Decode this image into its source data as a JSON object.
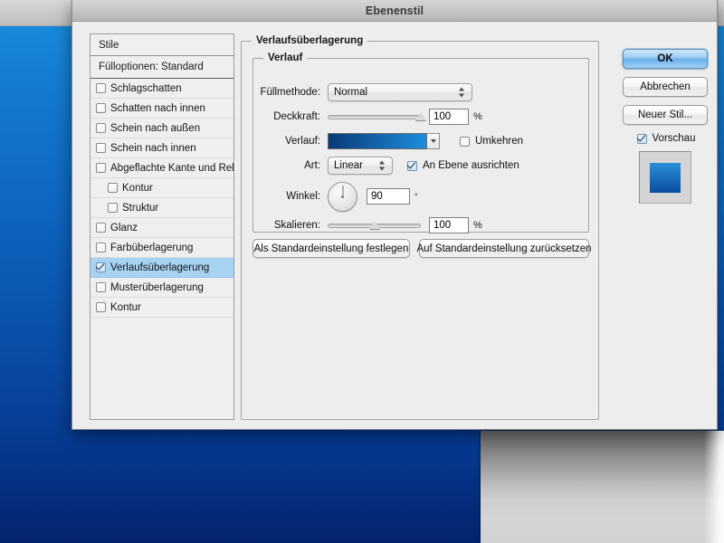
{
  "window": {
    "title": "Ebenenstil"
  },
  "styles_panel": {
    "header": "Stile",
    "fill_options": "Fülloptionen: Standard",
    "items": [
      {
        "label": "Schlagschatten",
        "checked": false,
        "indent": false,
        "selected": false
      },
      {
        "label": "Schatten nach innen",
        "checked": false,
        "indent": false,
        "selected": false
      },
      {
        "label": "Schein nach außen",
        "checked": false,
        "indent": false,
        "selected": false
      },
      {
        "label": "Schein nach innen",
        "checked": false,
        "indent": false,
        "selected": false
      },
      {
        "label": "Abgeflachte Kante und Relief",
        "checked": false,
        "indent": false,
        "selected": false
      },
      {
        "label": "Kontur",
        "checked": false,
        "indent": true,
        "selected": false
      },
      {
        "label": "Struktur",
        "checked": false,
        "indent": true,
        "selected": false
      },
      {
        "label": "Glanz",
        "checked": false,
        "indent": false,
        "selected": false
      },
      {
        "label": "Farbüberlagerung",
        "checked": false,
        "indent": false,
        "selected": false
      },
      {
        "label": "Verlaufsüberlagerung",
        "checked": true,
        "indent": false,
        "selected": true
      },
      {
        "label": "Musterüberlagerung",
        "checked": false,
        "indent": false,
        "selected": false
      },
      {
        "label": "Kontur",
        "checked": false,
        "indent": false,
        "selected": false
      }
    ]
  },
  "main": {
    "group_title": "Verlaufsüberlagerung",
    "inner_group_title": "Verlauf",
    "blend_mode": {
      "label": "Füllmethode:",
      "value": "Normal"
    },
    "opacity": {
      "label": "Deckkraft:",
      "value": "100",
      "unit": "%",
      "percent": 100
    },
    "gradient": {
      "label": "Verlauf:",
      "from": "#093a77",
      "to": "#1e8ddd"
    },
    "reverse": {
      "label": "Umkehren",
      "checked": false
    },
    "style": {
      "label": "Art:",
      "value": "Linear"
    },
    "align": {
      "label": "An Ebene ausrichten",
      "checked": true
    },
    "angle": {
      "label": "Winkel:",
      "value": "90",
      "unit": "°"
    },
    "scale": {
      "label": "Skalieren:",
      "value": "100",
      "unit": "%",
      "percent": 50
    },
    "make_default_button": "Als Standardeinstellung festlegen",
    "reset_default_button": "Auf Standardeinstellung zurücksetzen"
  },
  "buttons": {
    "ok": "OK",
    "cancel": "Abbrechen",
    "new_style": "Neuer Stil...",
    "preview": {
      "label": "Vorschau",
      "checked": true
    }
  },
  "preview": {
    "swatch_top": "#2a8fd6",
    "swatch_bottom": "#0a4d9e"
  },
  "desktop": {
    "wallpaper_top": "#1b8ede",
    "wallpaper_bottom": "#03246c"
  }
}
